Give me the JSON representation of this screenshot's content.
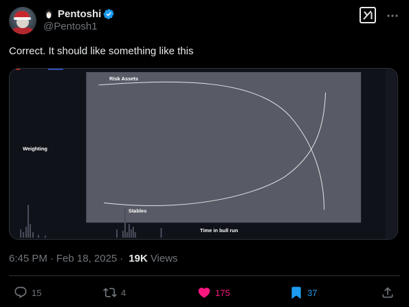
{
  "author": {
    "display_name": "Pentoshi",
    "handle": "@Pentosh1",
    "emoji_icon": "penguin-icon",
    "verified": true
  },
  "tweet": {
    "text": "Correct. It should like something like this"
  },
  "media": {
    "label_top_curve": "Risk Assets",
    "label_bottom_curve": "Stables",
    "y_axis_label": "Weighting",
    "x_axis_label": "Time in bull run"
  },
  "meta": {
    "time": "6:45 PM",
    "date": "Feb 18, 2025",
    "views_count": "19K",
    "views_label": "Views",
    "separator": "·"
  },
  "actions": {
    "reply_count": "15",
    "repost_count": "4",
    "like_count": "175",
    "bookmark_count": "37"
  },
  "colors": {
    "background": "#000000",
    "text": "#e7e9ea",
    "muted": "#71767b",
    "like": "#f91880",
    "bookmark": "#1d9bf0",
    "verified": "#1d9bf0",
    "chart_panel": "#585b66"
  }
}
